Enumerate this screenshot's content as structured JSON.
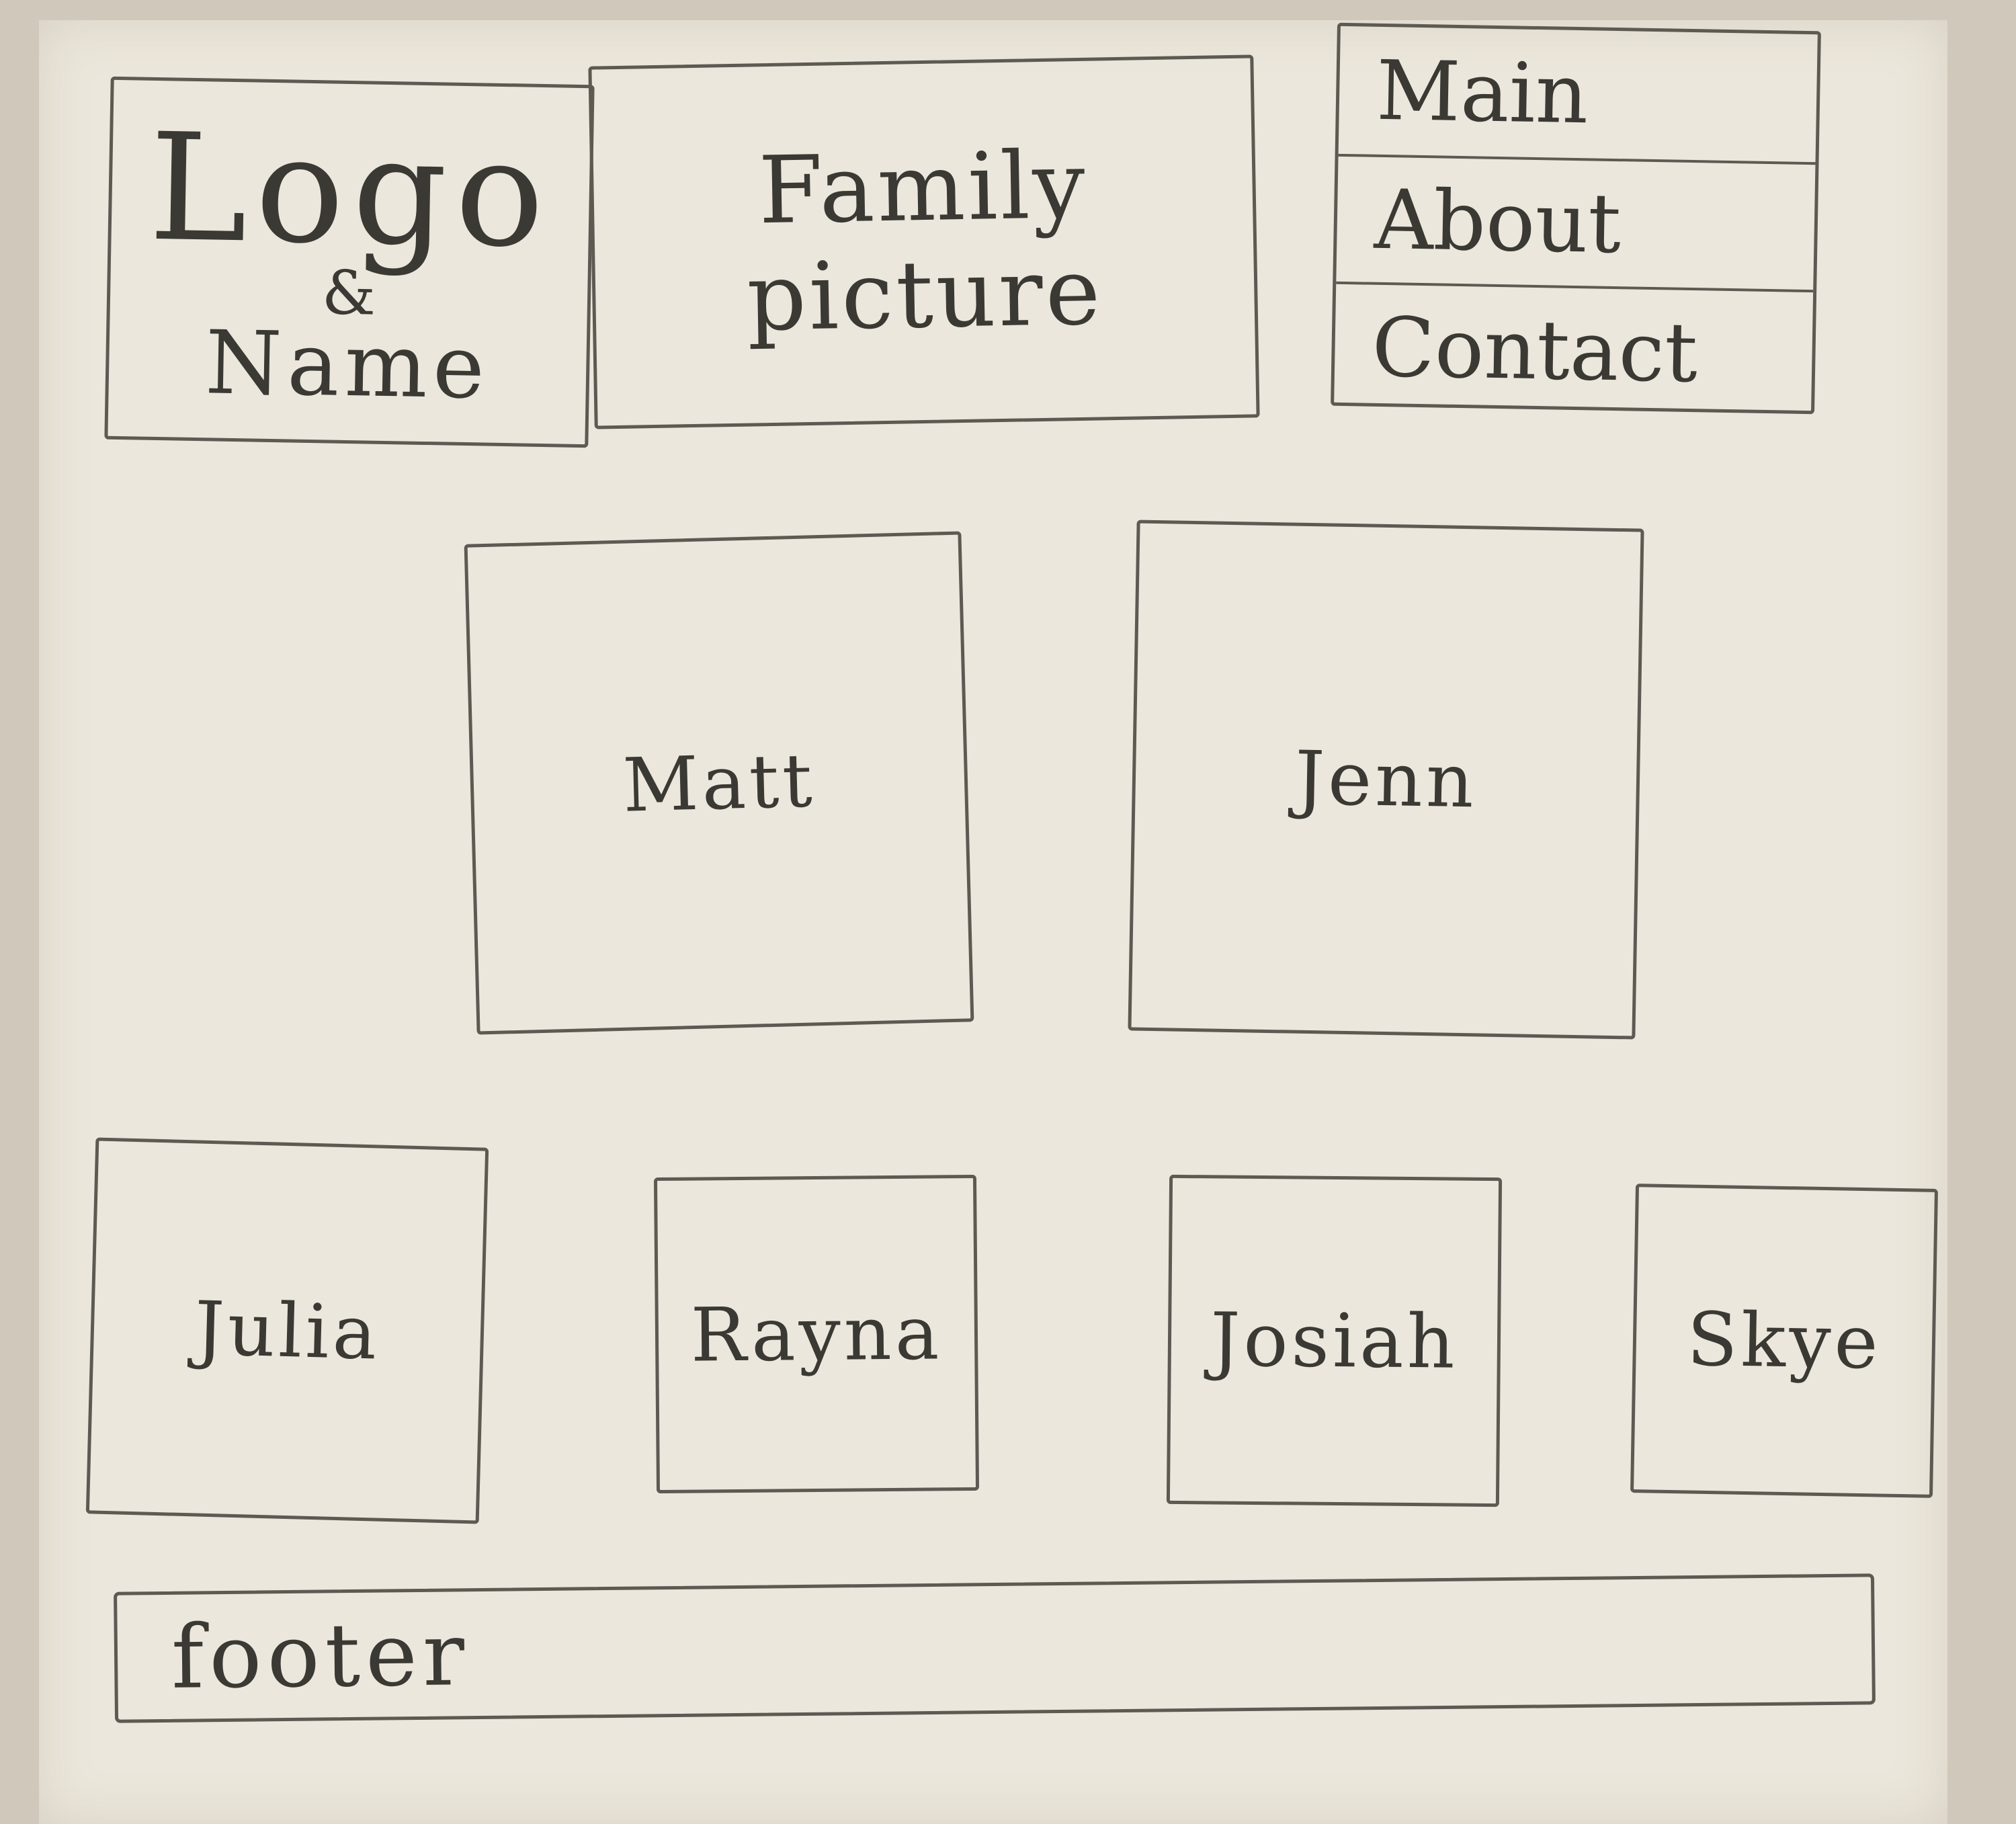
{
  "header": {
    "logo": {
      "line1": "Logo",
      "line2": "&",
      "line3": "Name"
    },
    "family_picture": {
      "line1": "Family",
      "line2": "picture"
    },
    "nav": {
      "items": [
        {
          "label": "Main"
        },
        {
          "label": "About"
        },
        {
          "label": "Contact"
        }
      ]
    }
  },
  "parents": [
    {
      "name": "Matt"
    },
    {
      "name": "Jenn"
    }
  ],
  "children": [
    {
      "name": "Julia"
    },
    {
      "name": "Rayna"
    },
    {
      "name": "Josiah"
    },
    {
      "name": "Skye"
    }
  ],
  "footer": {
    "label": "footer"
  }
}
